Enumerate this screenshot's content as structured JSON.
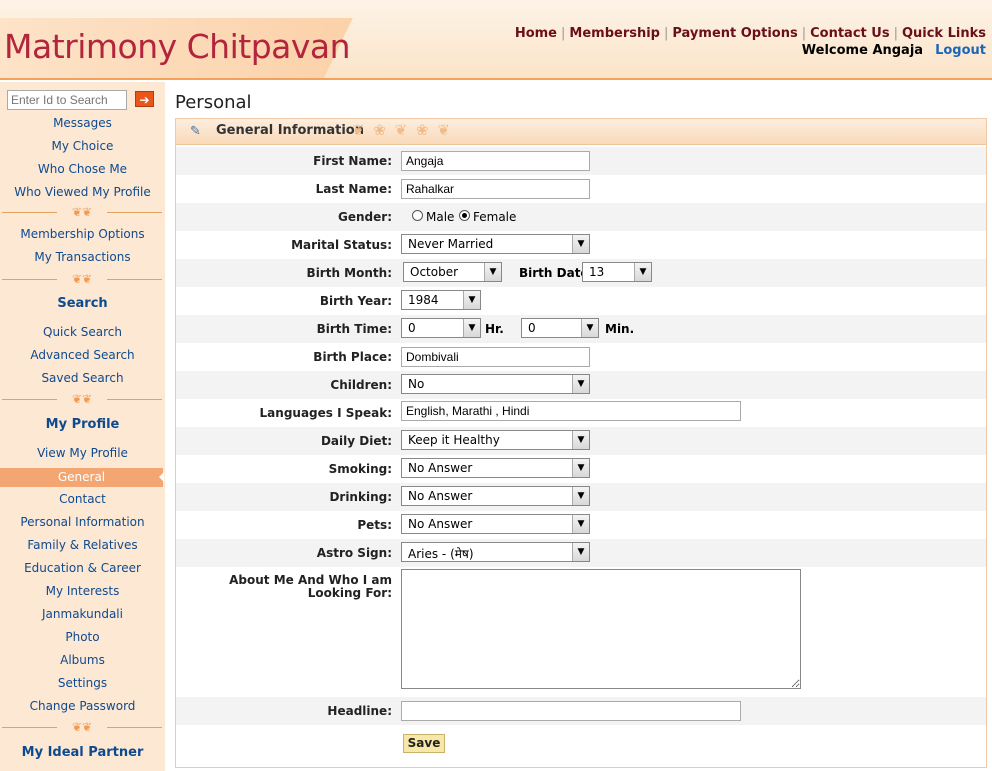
{
  "header": {
    "logo": "Matrimony Chitpavan",
    "nav": [
      "Home",
      "Membership",
      "Payment Options",
      "Contact Us",
      "Quick Links"
    ],
    "welcome": "Welcome Angaja",
    "logout": "Logout"
  },
  "sidebar": {
    "search_placeholder": "Enter Id to Search",
    "go_icon": "arrow-right-icon",
    "group1": [
      "Messages",
      "My Choice",
      "Who Chose Me",
      "Who Viewed My Profile"
    ],
    "group2": [
      "Membership Options",
      "My Transactions"
    ],
    "search_heading": "Search",
    "search_links": [
      "Quick Search",
      "Advanced Search",
      "Saved Search"
    ],
    "profile_heading": "My Profile",
    "profile_links": [
      "View My Profile",
      "General",
      "Contact",
      "Personal Information",
      "Family & Relatives",
      "Education & Career",
      "My Interests",
      "Janmakundali",
      "Photo",
      "Albums",
      "Settings",
      "Change Password"
    ],
    "active_item": "General",
    "partner_heading": "My Ideal Partner"
  },
  "page": {
    "title": "Personal",
    "panel_title": "General Information"
  },
  "form": {
    "first_name": {
      "label": "First Name:",
      "value": "Angaja"
    },
    "last_name": {
      "label": "Last Name:",
      "value": "Rahalkar"
    },
    "gender": {
      "label": "Gender:",
      "options": [
        "Male",
        "Female"
      ],
      "selected": "Female"
    },
    "marital_status": {
      "label": "Marital Status:",
      "value": "Never Married"
    },
    "birth_month": {
      "label": "Birth Month:",
      "value": "October"
    },
    "birth_date": {
      "label": "Birth Date:",
      "value": "13"
    },
    "birth_year": {
      "label": "Birth Year:",
      "value": "1984"
    },
    "birth_time": {
      "label": "Birth Time:",
      "hour": "0",
      "hour_unit": "Hr.",
      "minute": "0",
      "minute_unit": "Min."
    },
    "birth_place": {
      "label": "Birth Place:",
      "value": "Dombivali"
    },
    "children": {
      "label": "Children:",
      "value": "No"
    },
    "languages": {
      "label": "Languages I Speak:",
      "value": "English, Marathi , Hindi"
    },
    "daily_diet": {
      "label": "Daily Diet:",
      "value": "Keep it Healthy"
    },
    "smoking": {
      "label": "Smoking:",
      "value": "No Answer"
    },
    "drinking": {
      "label": "Drinking:",
      "value": "No Answer"
    },
    "pets": {
      "label": "Pets:",
      "value": "No Answer"
    },
    "astro_sign": {
      "label": "Astro Sign:",
      "value": "Aries - (मेष)"
    },
    "about": {
      "label": "About Me And Who I am Looking For:",
      "value": ""
    },
    "headline": {
      "label": "Headline:",
      "value": ""
    },
    "save": "Save"
  }
}
